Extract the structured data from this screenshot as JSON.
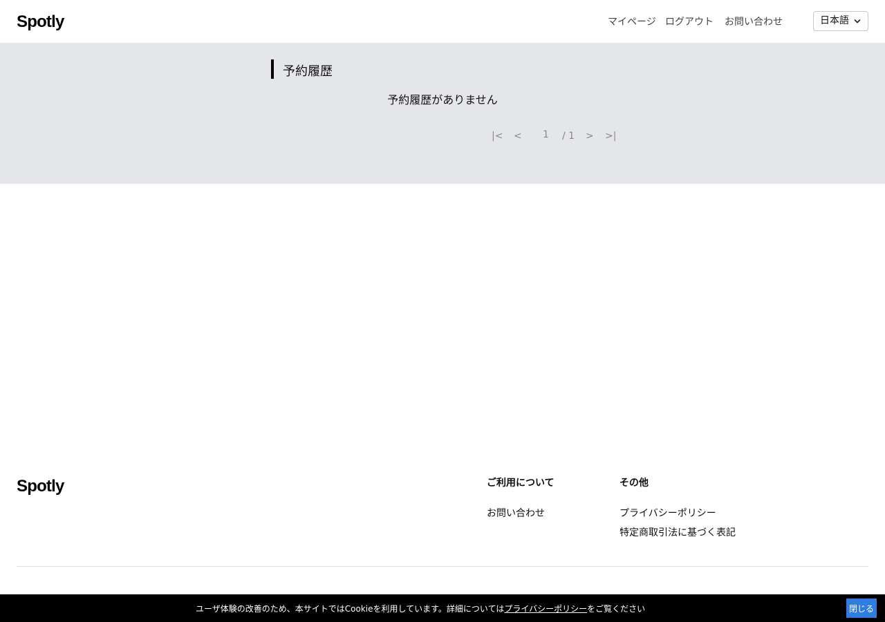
{
  "header": {
    "logo": "Spotly",
    "nav": {
      "mypage": "マイページ",
      "logout": "ログアウト",
      "contact": "お問い合わせ"
    },
    "language": {
      "selected": "日本語",
      "icon": "chevron-down-icon"
    }
  },
  "main": {
    "title": "予約履歴",
    "empty_message": "予約履歴がありません",
    "pagination": {
      "first": "|<",
      "prev": "<",
      "current_page": "1",
      "total": "/ 1",
      "next": ">",
      "last": ">|"
    }
  },
  "footer": {
    "logo": "Spotly",
    "columns": [
      {
        "heading": "ご利用について",
        "links": [
          "お問い合わせ"
        ]
      },
      {
        "heading": "その他",
        "links": [
          "プライバシーポリシー",
          "特定商取引法に基づく表記"
        ]
      }
    ]
  },
  "cookie_banner": {
    "text_before": "ユーザ体験の改善のため、本サイトではCookieを利用しています。詳細については",
    "link_text": "プライバシーポリシー",
    "text_after": "をご覧ください",
    "close_label": "閉じる",
    "close_color": "#2f7de1"
  }
}
